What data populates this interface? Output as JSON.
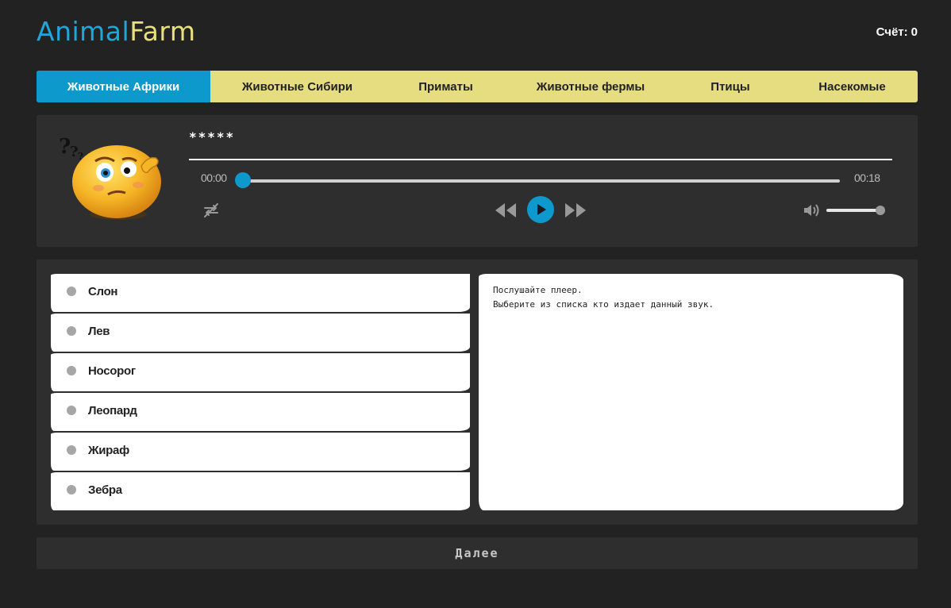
{
  "logo": {
    "part1": "Animal",
    "part2": "Farm"
  },
  "score": {
    "label": "Счёт:",
    "value": "0"
  },
  "tabs": [
    {
      "label": "Животные Африки",
      "active": true
    },
    {
      "label": "Животные Сибири",
      "active": false
    },
    {
      "label": "Приматы",
      "active": false
    },
    {
      "label": "Животные фермы",
      "active": false
    },
    {
      "label": "Птицы",
      "active": false
    },
    {
      "label": "Насекомые",
      "active": false
    }
  ],
  "player": {
    "title": "*****",
    "current_time": "00:00",
    "duration": "00:18",
    "progress": 0,
    "volume": 1.0,
    "accent_color": "#0d99cc"
  },
  "options": [
    {
      "label": "Слон"
    },
    {
      "label": "Лев"
    },
    {
      "label": "Носорог"
    },
    {
      "label": "Леопард"
    },
    {
      "label": "Жираф"
    },
    {
      "label": "Зебра"
    }
  ],
  "info": {
    "line1": "Послушайте плеер.",
    "line2": "Выберите из списка кто издает данный звук."
  },
  "next_button": "Далее",
  "colors": {
    "background": "#222222",
    "panel": "#2e2e2e",
    "tabs_bg": "#e6dd80",
    "accent": "#0d99cc"
  }
}
